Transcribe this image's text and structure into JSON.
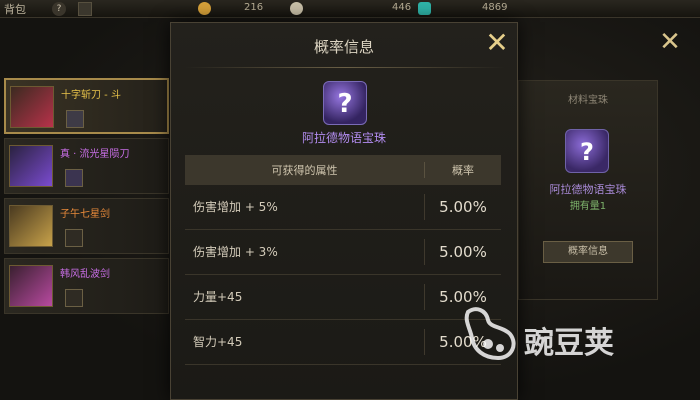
{
  "topbar": {
    "tab_label": "背包",
    "help_glyph": "?",
    "currency_1": "216",
    "currency_2": "446",
    "currency_3": "4869"
  },
  "left_list": [
    {
      "name": "十字斩刀 - 斗",
      "name_color": "#e8c34a",
      "thumb_color": "#b8324a"
    },
    {
      "name": "真 · 流光星陨刀",
      "name_color": "#c86ee6",
      "thumb_color": "#7b4bd0"
    },
    {
      "name": "子午七星剑",
      "name_color": "#e88a3a",
      "thumb_color": "#c8a24a"
    },
    {
      "name": "韩风乱波剑",
      "name_color": "#c86ee6",
      "thumb_color": "#b84aa0"
    }
  ],
  "right_card": {
    "header": "材料宝珠",
    "item_name": "阿拉德物语宝珠",
    "owned": "拥有量1",
    "button_label": "概率信息"
  },
  "modal": {
    "title": "概率信息",
    "item_name": "阿拉德物语宝珠",
    "item_glyph": "?",
    "col_attribute": "可获得的属性",
    "col_rate": "概率",
    "rows": [
      {
        "attribute": "伤害增加 + 5%",
        "rate": "5.00%"
      },
      {
        "attribute": "伤害增加 + 3%",
        "rate": "5.00%"
      },
      {
        "attribute": "力量+45",
        "rate": "5.00%"
      },
      {
        "attribute": "智力+45",
        "rate": "5.00%"
      }
    ]
  },
  "watermark": {
    "text": "豌豆荚"
  },
  "colors": {
    "accent_gold": "#e6cf8a",
    "orb_purple": "#b28cf0"
  }
}
